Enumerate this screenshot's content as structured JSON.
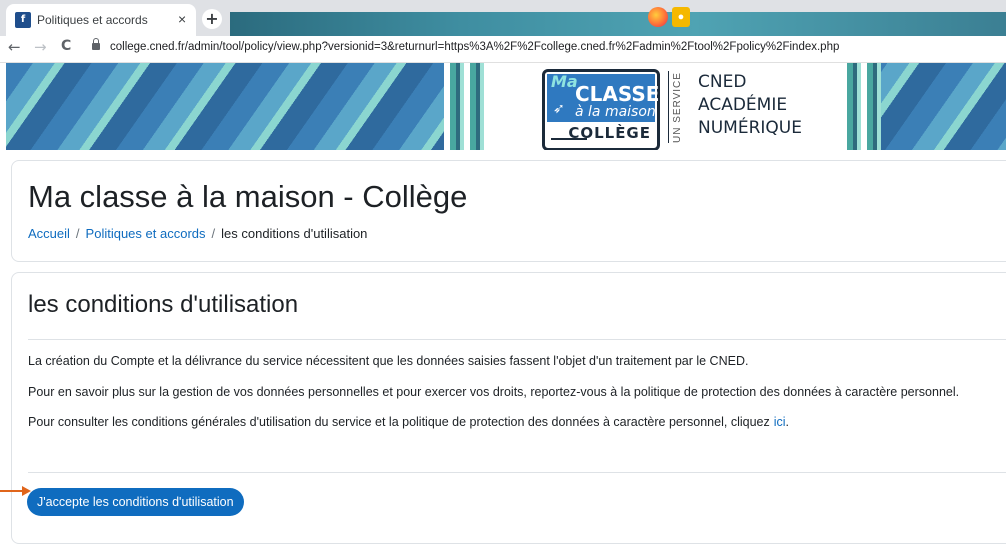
{
  "browser": {
    "tab_title": "Politiques et accords",
    "tab_close": "×",
    "new_tab": "+",
    "url": "college.cned.fr/admin/tool/policy/view.php?versionid=3&returnurl=https%3A%2F%2Fcollege.cned.fr%2Fadmin%2Ftool%2Fpolicy%2Findex.php",
    "back": "←",
    "forward": "→",
    "reload": "C"
  },
  "banner": {
    "logo_ma": "Ma",
    "logo_classe": "CLASSE",
    "logo_alamaison": "à la maison",
    "logo_college": "COLLÈGE",
    "logo_unservice": "UN SERVICE",
    "logo_cned_lines": [
      "CNED",
      "ACADÉMIE",
      "NUMÉRIQUE"
    ]
  },
  "header": {
    "title": "Ma classe à la maison - Collège",
    "breadcrumb": {
      "home": "Accueil",
      "sep": "/",
      "policies": "Politiques et accords",
      "current": "les conditions d'utilisation"
    }
  },
  "policy": {
    "title": "les conditions d'utilisation",
    "paragraph1": "La création du Compte et la délivrance du service nécessitent que les données saisies fassent l'objet d'un traitement par le CNED.",
    "paragraph2": "Pour en savoir plus sur la gestion de vos données personnelles et pour exercer vos droits, reportez-vous à la politique de protection des données à caractère personnel.",
    "paragraph3": "Pour consulter les conditions générales d'utilisation du service et la politique de protection des données à caractère personnel, cliquez",
    "link_ici": "ici",
    "paragraph3_end": ".",
    "accept_button": "J'accepte les conditions d'utilisation"
  },
  "colors": {
    "accent": "#0f6cbf",
    "annotation_arrow": "#e0651b"
  }
}
